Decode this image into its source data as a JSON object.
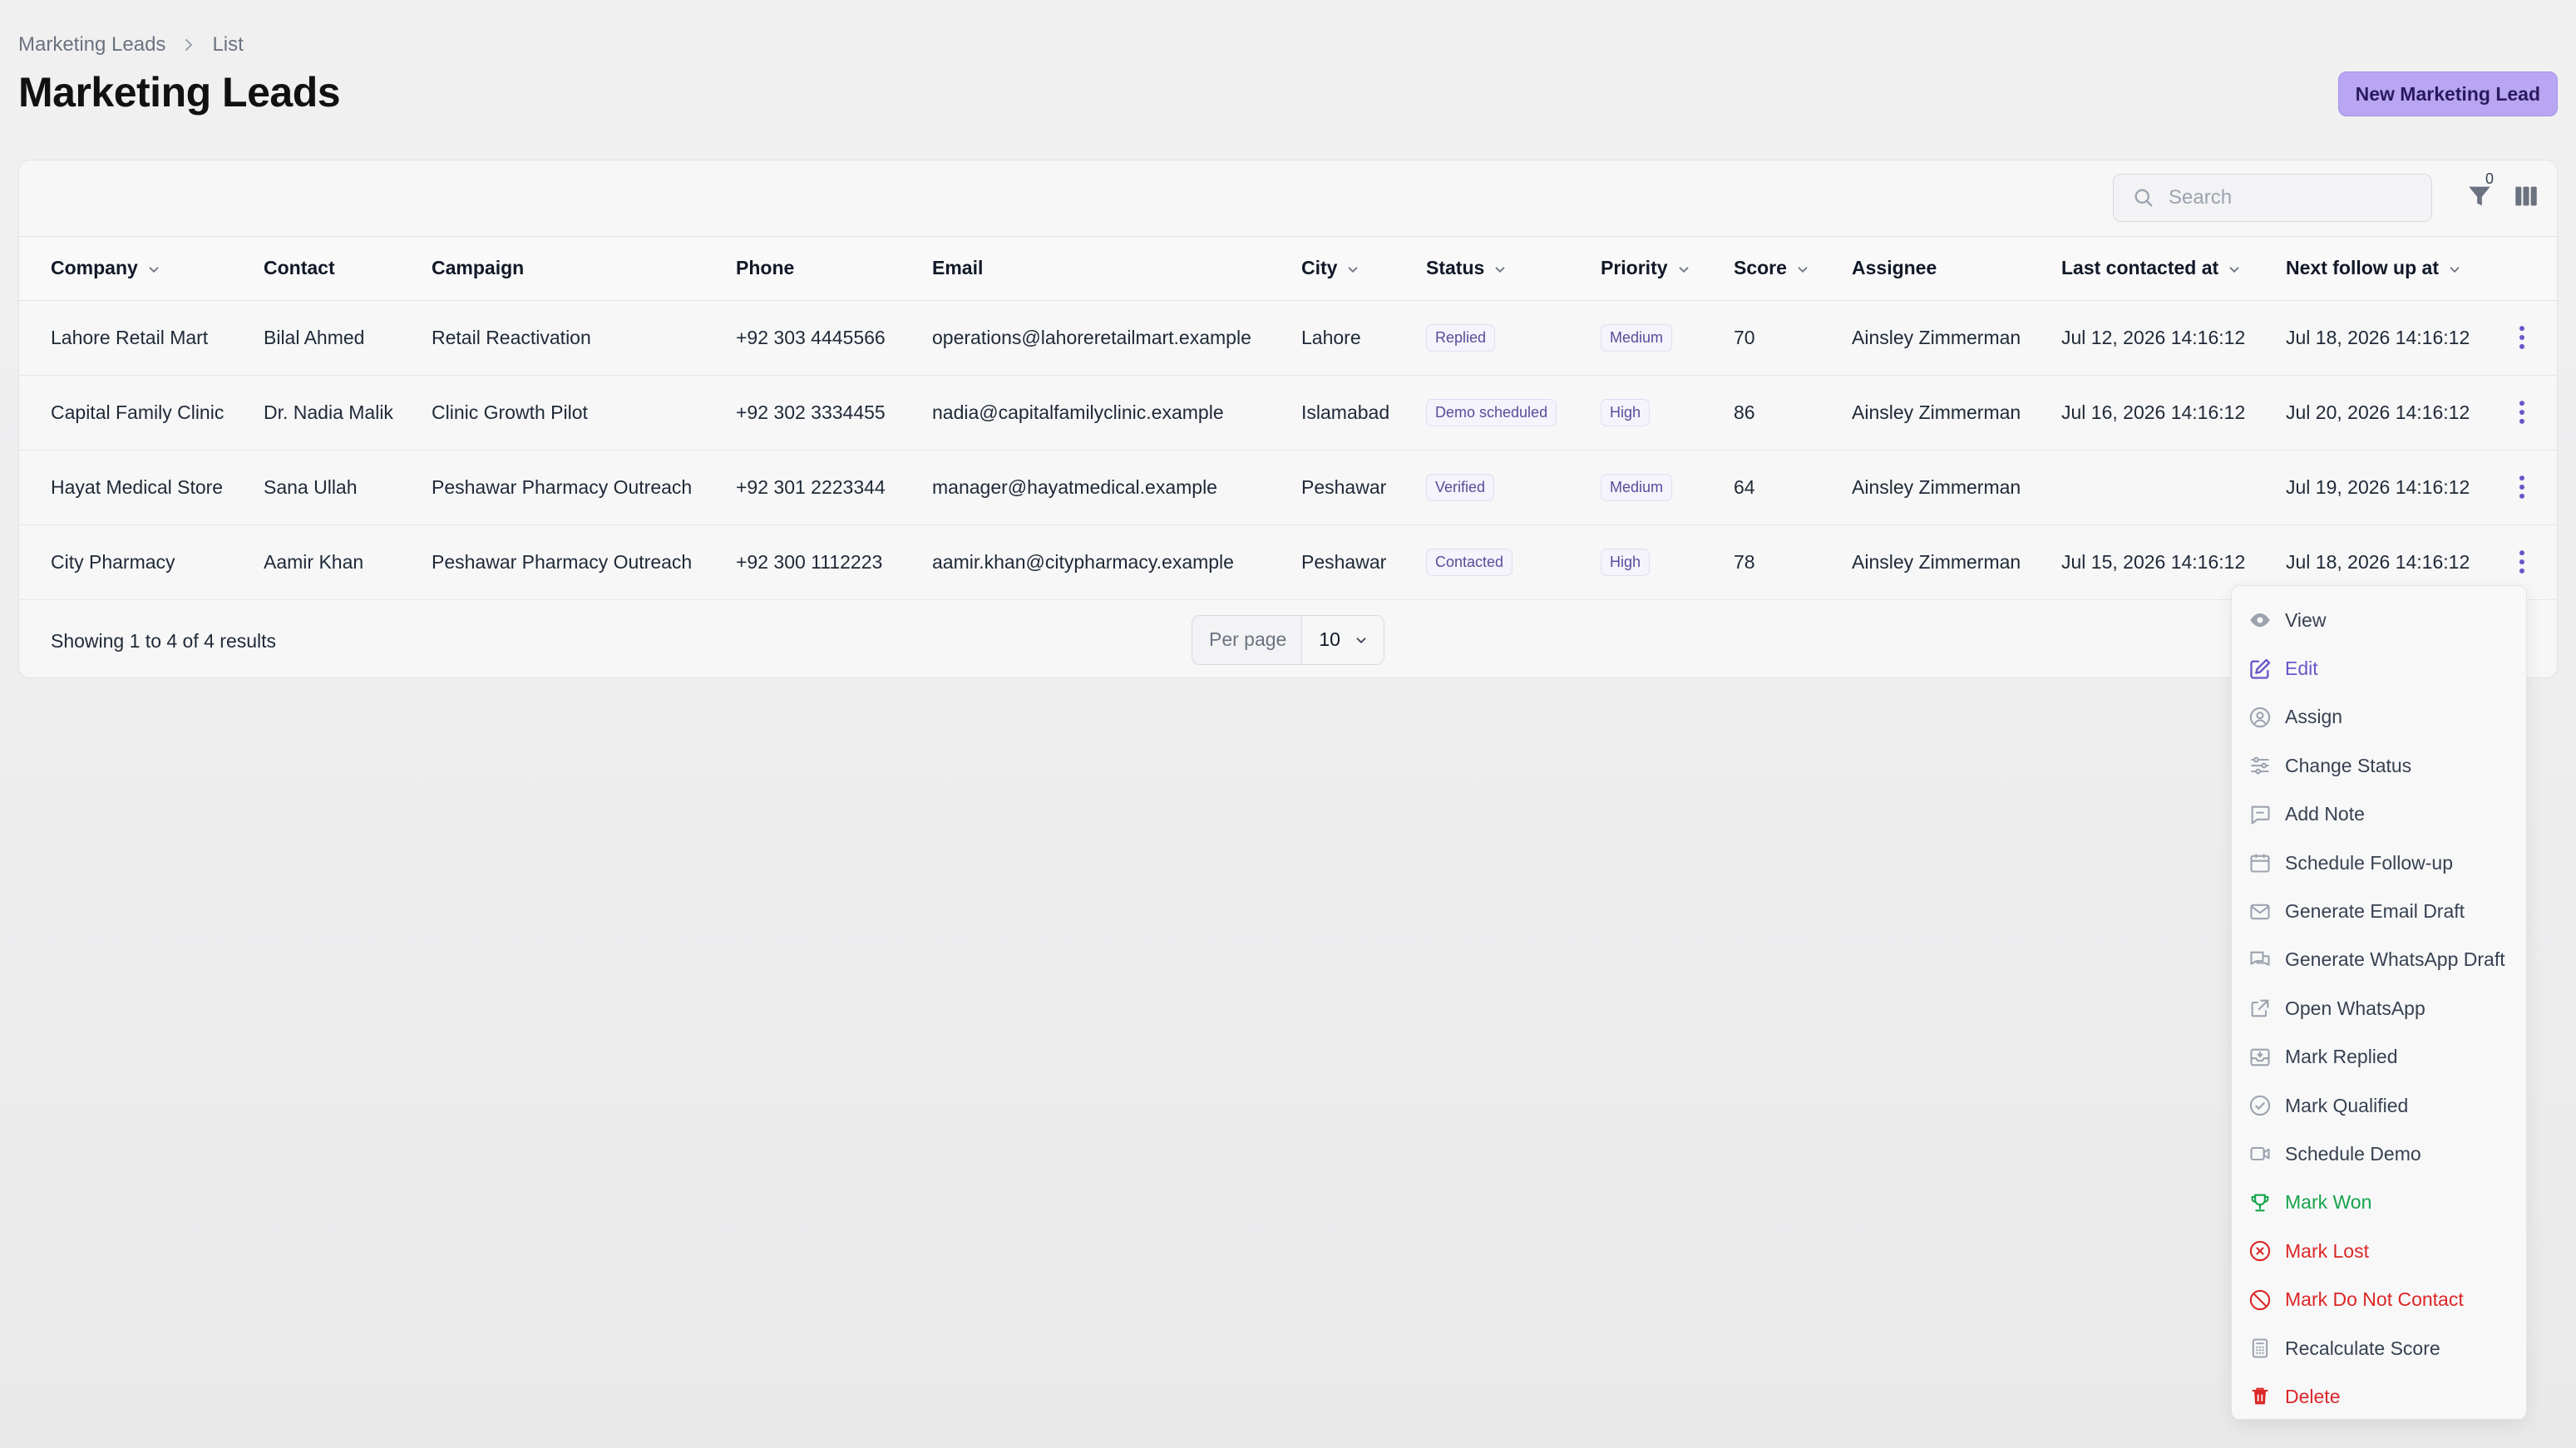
{
  "breadcrumb": {
    "root": "Marketing Leads",
    "current": "List"
  },
  "page": {
    "title": "Marketing Leads",
    "new_button": "New Marketing Lead"
  },
  "toolbar": {
    "search_placeholder": "Search",
    "filter_count": "0"
  },
  "table": {
    "columns": [
      "Company",
      "Contact",
      "Campaign",
      "Phone",
      "Email",
      "City",
      "Status",
      "Priority",
      "Score",
      "Assignee",
      "Last contacted at",
      "Next follow up at"
    ],
    "rows": [
      {
        "company": "Lahore Retail Mart",
        "contact": "Bilal Ahmed",
        "campaign": "Retail Reactivation",
        "phone": "+92 303 4445566",
        "email": "operations@lahoreretailmart.example",
        "city": "Lahore",
        "status": "Replied",
        "priority": "Medium",
        "score": "70",
        "assignee": "Ainsley Zimmerman",
        "last_contacted": "Jul 12, 2026 14:16:12",
        "next_follow_up": "Jul 18, 2026 14:16:12"
      },
      {
        "company": "Capital Family Clinic",
        "contact": "Dr. Nadia Malik",
        "campaign": "Clinic Growth Pilot",
        "phone": "+92 302 3334455",
        "email": "nadia@capitalfamilyclinic.example",
        "city": "Islamabad",
        "status": "Demo scheduled",
        "priority": "High",
        "score": "86",
        "assignee": "Ainsley Zimmerman",
        "last_contacted": "Jul 16, 2026 14:16:12",
        "next_follow_up": "Jul 20, 2026 14:16:12"
      },
      {
        "company": "Hayat Medical Store",
        "contact": "Sana Ullah",
        "campaign": "Peshawar Pharmacy Outreach",
        "phone": "+92 301 2223344",
        "email": "manager@hayatmedical.example",
        "city": "Peshawar",
        "status": "Verified",
        "priority": "Medium",
        "score": "64",
        "assignee": "Ainsley Zimmerman",
        "last_contacted": "",
        "next_follow_up": "Jul 19, 2026 14:16:12"
      },
      {
        "company": "City Pharmacy",
        "contact": "Aamir Khan",
        "campaign": "Peshawar Pharmacy Outreach",
        "phone": "+92 300 1112223",
        "email": "aamir.khan@citypharmacy.example",
        "city": "Peshawar",
        "status": "Contacted",
        "priority": "High",
        "score": "78",
        "assignee": "Ainsley Zimmerman",
        "last_contacted": "Jul 15, 2026 14:16:12",
        "next_follow_up": "Jul 18, 2026 14:16:12"
      }
    ]
  },
  "footer": {
    "results": "Showing 1 to 4 of 4 results",
    "per_page_label": "Per page",
    "per_page_value": "10"
  },
  "menu": {
    "items": [
      {
        "label": "View",
        "icon": "eye-icon"
      },
      {
        "label": "Edit",
        "icon": "pencil-square-icon"
      },
      {
        "label": "Assign",
        "icon": "user-circle-icon"
      },
      {
        "label": "Change Status",
        "icon": "sliders-icon"
      },
      {
        "label": "Add Note",
        "icon": "chat-bubble-icon"
      },
      {
        "label": "Schedule Follow-up",
        "icon": "calendar-icon"
      },
      {
        "label": "Generate Email Draft",
        "icon": "envelope-icon"
      },
      {
        "label": "Generate WhatsApp Draft",
        "icon": "chat-bubbles-icon"
      },
      {
        "label": "Open WhatsApp",
        "icon": "external-link-icon"
      },
      {
        "label": "Mark Replied",
        "icon": "inbox-icon"
      },
      {
        "label": "Mark Qualified",
        "icon": "check-circle-icon"
      },
      {
        "label": "Schedule Demo",
        "icon": "video-camera-icon"
      },
      {
        "label": "Mark Won",
        "icon": "trophy-icon"
      },
      {
        "label": "Mark Lost",
        "icon": "x-circle-icon"
      },
      {
        "label": "Mark Do Not Contact",
        "icon": "no-symbol-icon"
      },
      {
        "label": "Recalculate Score",
        "icon": "calculator-icon"
      },
      {
        "label": "Delete",
        "icon": "trash-icon"
      }
    ]
  },
  "colors": {
    "primary": "#b8a6f2",
    "primary_text": "#6b55c9",
    "success": "#16a34a",
    "danger": "#dc2626"
  }
}
